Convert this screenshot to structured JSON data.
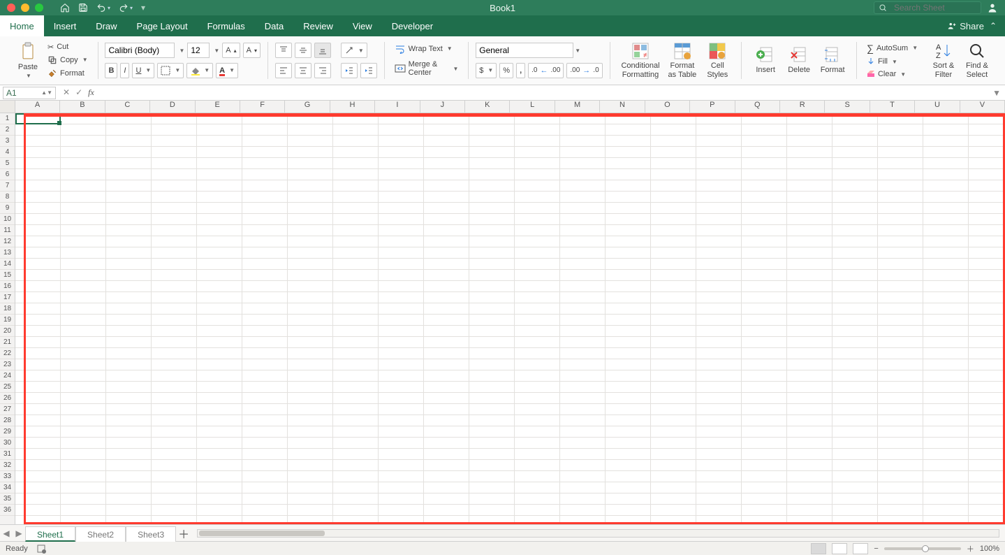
{
  "window": {
    "title": "Book1",
    "search_placeholder": "Search Sheet"
  },
  "tabs": {
    "items": [
      "Home",
      "Insert",
      "Draw",
      "Page Layout",
      "Formulas",
      "Data",
      "Review",
      "View",
      "Developer"
    ],
    "active": "Home",
    "share_label": "Share"
  },
  "ribbon": {
    "clipboard": {
      "paste": "Paste",
      "cut": "Cut",
      "copy": "Copy",
      "format_painter": "Format"
    },
    "font": {
      "name": "Calibri (Body)",
      "size": "12",
      "bold": "B",
      "italic": "I",
      "underline": "U"
    },
    "alignment": {
      "wrap": "Wrap Text",
      "merge": "Merge & Center"
    },
    "number": {
      "format": "General"
    },
    "styles": {
      "cond": "Conditional\nFormatting",
      "table": "Format\nas Table",
      "cell": "Cell\nStyles"
    },
    "cells": {
      "insert": "Insert",
      "delete": "Delete",
      "format": "Format"
    },
    "editing": {
      "autosum": "AutoSum",
      "fill": "Fill",
      "clear": "Clear",
      "sort": "Sort &\nFilter",
      "find": "Find &\nSelect"
    }
  },
  "formula_bar": {
    "name_box": "A1",
    "formula": ""
  },
  "grid": {
    "columns": [
      "A",
      "B",
      "C",
      "D",
      "E",
      "F",
      "G",
      "H",
      "I",
      "J",
      "K",
      "L",
      "M",
      "N",
      "O",
      "P",
      "Q",
      "R",
      "S",
      "T",
      "U",
      "V"
    ],
    "rows": 36,
    "selection": "A1"
  },
  "sheets": {
    "items": [
      "Sheet1",
      "Sheet2",
      "Sheet3"
    ],
    "active": "Sheet1"
  },
  "status": {
    "ready": "Ready",
    "zoom": "100%"
  }
}
